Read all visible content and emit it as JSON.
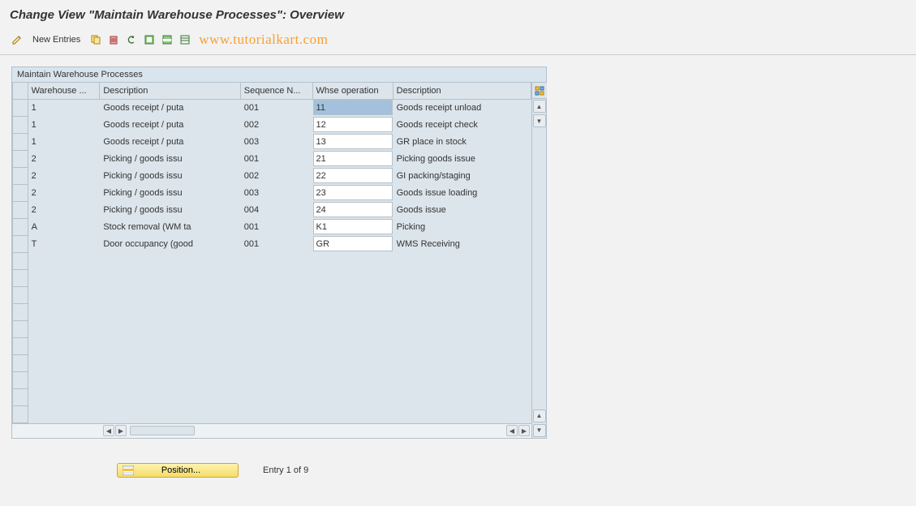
{
  "header": {
    "title": "Change View \"Maintain Warehouse Processes\": Overview"
  },
  "toolbar": {
    "new_entries": "New Entries"
  },
  "watermark": "www.tutorialkart.com",
  "panel": {
    "title": "Maintain Warehouse Processes",
    "columns": {
      "warehouse": "Warehouse ...",
      "description": "Description",
      "sequence": "Sequence N...",
      "operation": "Whse operation",
      "description2": "Description"
    },
    "rows": [
      {
        "warehouse": "1",
        "desc": "Goods receipt / puta",
        "seq": "001",
        "op": "11",
        "desc2": "Goods receipt unload",
        "selected": true
      },
      {
        "warehouse": "1",
        "desc": "Goods receipt / puta",
        "seq": "002",
        "op": "12",
        "desc2": "Goods receipt check"
      },
      {
        "warehouse": "1",
        "desc": "Goods receipt / puta",
        "seq": "003",
        "op": "13",
        "desc2": "GR place in stock"
      },
      {
        "warehouse": "2",
        "desc": "Picking / goods issu",
        "seq": "001",
        "op": "21",
        "desc2": "Picking goods issue"
      },
      {
        "warehouse": "2",
        "desc": "Picking / goods issu",
        "seq": "002",
        "op": "22",
        "desc2": "GI packing/staging"
      },
      {
        "warehouse": "2",
        "desc": "Picking / goods issu",
        "seq": "003",
        "op": "23",
        "desc2": "Goods issue loading"
      },
      {
        "warehouse": "2",
        "desc": "Picking / goods issu",
        "seq": "004",
        "op": "24",
        "desc2": "Goods issue"
      },
      {
        "warehouse": "A",
        "desc": "Stock removal (WM ta",
        "seq": "001",
        "op": "K1",
        "desc2": "Picking"
      },
      {
        "warehouse": "T",
        "desc": "Door occupancy (good",
        "seq": "001",
        "op": "GR",
        "desc2": "WMS Receiving"
      }
    ],
    "blank_rows": 10
  },
  "footer": {
    "position_label": "Position...",
    "entry_text": "Entry 1 of 9"
  }
}
